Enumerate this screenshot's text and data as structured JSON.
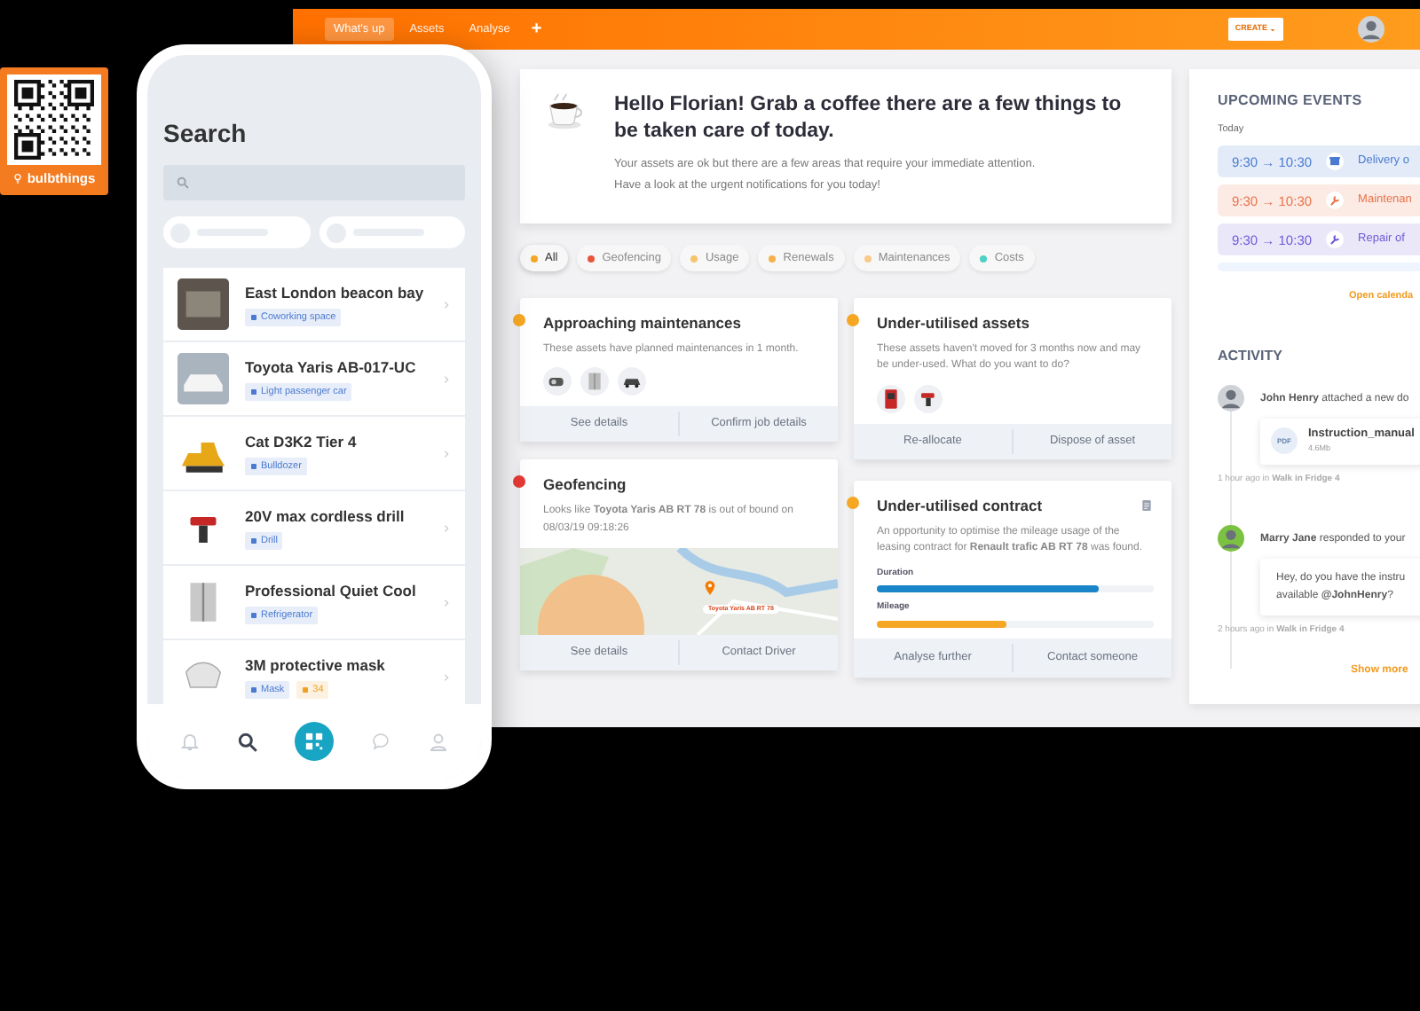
{
  "qr_badge": {
    "label": "bulbthings"
  },
  "topbar": {
    "tabs": [
      {
        "label": "What's up",
        "selected": true
      },
      {
        "label": "Assets",
        "selected": false
      },
      {
        "label": "Analyse",
        "selected": false
      }
    ],
    "add_label": "+",
    "create_button": "CREATE"
  },
  "welcome": {
    "title": "Hello Florian! Grab a coffee there are a few things to be taken care of today.",
    "body": "Your assets are ok but there are a few areas that require your immediate attention.\nHave a look at the urgent notifications for you today!"
  },
  "filters": [
    {
      "label": "All",
      "color": "#f5a623",
      "selected": true
    },
    {
      "label": "Geofencing",
      "color": "#e8553d",
      "selected": false
    },
    {
      "label": "Usage",
      "color": "#f7c46c",
      "selected": false
    },
    {
      "label": "Renewals",
      "color": "#f5b04a",
      "selected": false
    },
    {
      "label": "Maintenances",
      "color": "#f8c98a",
      "selected": false
    },
    {
      "label": "Costs",
      "color": "#4fd1c5",
      "selected": false
    }
  ],
  "columns": [
    [
      {
        "kind": "assets",
        "color": "#f5a623",
        "title": "Approaching maintenances",
        "text": "These assets have planned maintenances in 1 month.",
        "actions": [
          "See details",
          "Confirm job details"
        ]
      },
      {
        "kind": "map",
        "color": "#e53935",
        "title": "Geofencing",
        "text": "Looks like **Toyota Yaris AB RT 78**  is out of bound on 08/03/19 09:18:26",
        "map_label": "Toyota Yaris AB RT 78",
        "actions": [
          "See details",
          "Contact Driver"
        ]
      }
    ],
    [
      {
        "kind": "tools",
        "color": "#f5a623",
        "title": "Under-utilised assets",
        "text": "These assets haven't moved for 3 months now and may be under-used. What do you want to do?",
        "actions": [
          "Re-allocate",
          "Dispose of asset"
        ]
      },
      {
        "kind": "contract",
        "color": "#f5a623",
        "title": "Under-utilised contract",
        "text": "An opportunity to optimise the mileage usage of the leasing contract for **Renault trafic AB RT 78** was found.",
        "bars": [
          {
            "label": "Duration",
            "level": 0.8,
            "color": "#1a86c9"
          },
          {
            "label": "Mileage",
            "level": 0.47,
            "color": "#f5a623"
          }
        ],
        "actions": [
          "Analyse further",
          "Contact someone"
        ]
      }
    ]
  ],
  "events": {
    "title": "UPCOMING EVENTS",
    "day": "Today",
    "items": [
      {
        "kind": "delivery",
        "time": "9:30 → 10:30",
        "title": "Delivery o",
        "color": "#4a7bd0"
      },
      {
        "kind": "maintenance",
        "time": "9:30 → 10:30",
        "title": "Maintenan",
        "color": "#e8744a"
      },
      {
        "kind": "repair",
        "time": "9:30 → 10:30",
        "title": "Repair of",
        "color": "#6f5bd6"
      }
    ],
    "link": "Open calenda"
  },
  "activity": {
    "title": "ACTIVITY",
    "items": [
      {
        "kind": "attachment",
        "text": "**John Henry** attached a new do",
        "file": {
          "type": "PDF",
          "name": "Instruction_manual",
          "size": "4.6Mb"
        },
        "meta": "1 hour ago in **Walk in Fridge 4**"
      },
      {
        "kind": "message",
        "text": "**Marry Jane** responded to your",
        "message": "Hey, do you have the instru\navailable **@JohnHenry**?",
        "meta": "2 hours ago in **Walk in Fridge 4**"
      }
    ],
    "show_more": "Show more"
  },
  "phone": {
    "title": "Search",
    "items": [
      {
        "title": "East London beacon bay",
        "tags": [
          {
            "label": "Coworking space",
            "color": "#4a7bd0"
          }
        ]
      },
      {
        "title": "Toyota Yaris AB-017-UC",
        "tags": [
          {
            "label": "Light passenger car",
            "color": "#4a7bd0"
          }
        ]
      },
      {
        "title": "Cat D3K2 Tier 4",
        "tags": [
          {
            "label": "Bulldozer",
            "color": "#4a7bd0"
          }
        ]
      },
      {
        "title": "20V max cordless drill",
        "tags": [
          {
            "label": "Drill",
            "color": "#4a7bd0"
          }
        ]
      },
      {
        "title": "Professional Quiet Cool",
        "tags": [
          {
            "label": "Refrigerator",
            "color": "#4a7bd0"
          }
        ]
      },
      {
        "title": "3M protective mask",
        "tags": [
          {
            "label": "Mask",
            "color": "#4a7bd0"
          },
          {
            "label": "34",
            "color": "#f0a020"
          }
        ]
      }
    ],
    "tabbar": [
      {
        "kind": "bell",
        "selected": false
      },
      {
        "kind": "search",
        "selected": true
      },
      {
        "kind": "scan",
        "selected": false
      },
      {
        "kind": "chat",
        "selected": false
      },
      {
        "kind": "user",
        "selected": false
      }
    ]
  }
}
